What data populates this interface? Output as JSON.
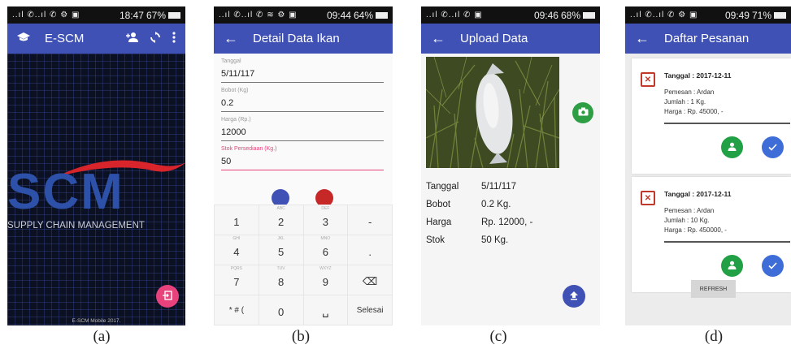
{
  "panel_a": {
    "status": {
      "left_icons": "..ıl ✆..ıl ✆ ⚙ ▣",
      "time": "18:47",
      "battery": "67%"
    },
    "app_title": "E-SCM",
    "logo_text": "SCM",
    "logo_subtitle": "SUPPLY CHAIN MANAGEMENT",
    "footer": "E-SCM Mobile 2017.",
    "icons": {
      "app": "school-icon",
      "add_user": "person-add-icon",
      "refresh": "sync-icon",
      "menu": "more-vert-icon",
      "login": "login-icon"
    },
    "caption": "(a)"
  },
  "panel_b": {
    "status": {
      "left_icons": "..ıl ✆..ıl ✆ ≋ ⚙ ▣",
      "time": "09:44",
      "battery": "64%"
    },
    "title": "Detail Data Ikan",
    "fields": [
      {
        "label": "Tanggal",
        "value": "5/11/117"
      },
      {
        "label": "Bobot (Kg)",
        "value": "0.2"
      },
      {
        "label": "Harga (Rp.)",
        "value": "12000"
      },
      {
        "label": "Stok Persediaan (Kg.)",
        "value": "50"
      }
    ],
    "keys": [
      {
        "sub": "",
        "main": "1"
      },
      {
        "sub": "ABC",
        "main": "2"
      },
      {
        "sub": "DEF",
        "main": "3"
      },
      {
        "sub": "",
        "main": "-"
      },
      {
        "sub": "GHI",
        "main": "4"
      },
      {
        "sub": "JKL",
        "main": "5"
      },
      {
        "sub": "MNO",
        "main": "6"
      },
      {
        "sub": "",
        "main": "."
      },
      {
        "sub": "PQRS",
        "main": "7"
      },
      {
        "sub": "TUV",
        "main": "8"
      },
      {
        "sub": "WXYZ",
        "main": "9"
      },
      {
        "sub": "",
        "main": "⌫"
      },
      {
        "sub": "",
        "main": "* # ("
      },
      {
        "sub": "",
        "main": "0"
      },
      {
        "sub": "",
        "main": "␣"
      },
      {
        "sub": "",
        "main": "Selesai"
      }
    ],
    "caption": "(b)"
  },
  "panel_c": {
    "status": {
      "left_icons": "..ıl ✆..ıl ✆ ▣",
      "time": "09:46",
      "battery": "68%"
    },
    "title": "Upload Data",
    "details": [
      {
        "key": "Tanggal",
        "value": "5/11/117"
      },
      {
        "key": "Bobot",
        "value": "0.2 Kg."
      },
      {
        "key": "Harga",
        "value": "Rp. 12000, -"
      },
      {
        "key": "Stok",
        "value": "50 Kg."
      }
    ],
    "caption": "(c)"
  },
  "panel_d": {
    "status": {
      "left_icons": "..ıl ✆..ıl ✆ ⚙ ▣",
      "time": "09:49",
      "battery": "71%"
    },
    "title": "Daftar Pesanan",
    "orders": [
      {
        "date": "Tanggal : 2017-12-11",
        "pemesan": "Pemesan : Ardan",
        "jumlah": "Jumlah : 1 Kg.",
        "harga": "Harga : Rp. 45000, -"
      },
      {
        "date": "Tanggal : 2017-12-11",
        "pemesan": "Pemesan : Ardan",
        "jumlah": "Jumlah : 10 Kg.",
        "harga": "Harga : Rp. 450000, -"
      }
    ],
    "refresh_label": "REFRESH",
    "caption": "(d)"
  },
  "colors": {
    "appbar": "#3f51b5",
    "accent_pink": "#e8427c",
    "green": "#22a045",
    "blue": "#3f6dd8",
    "calendar_red": "#c0392b"
  }
}
